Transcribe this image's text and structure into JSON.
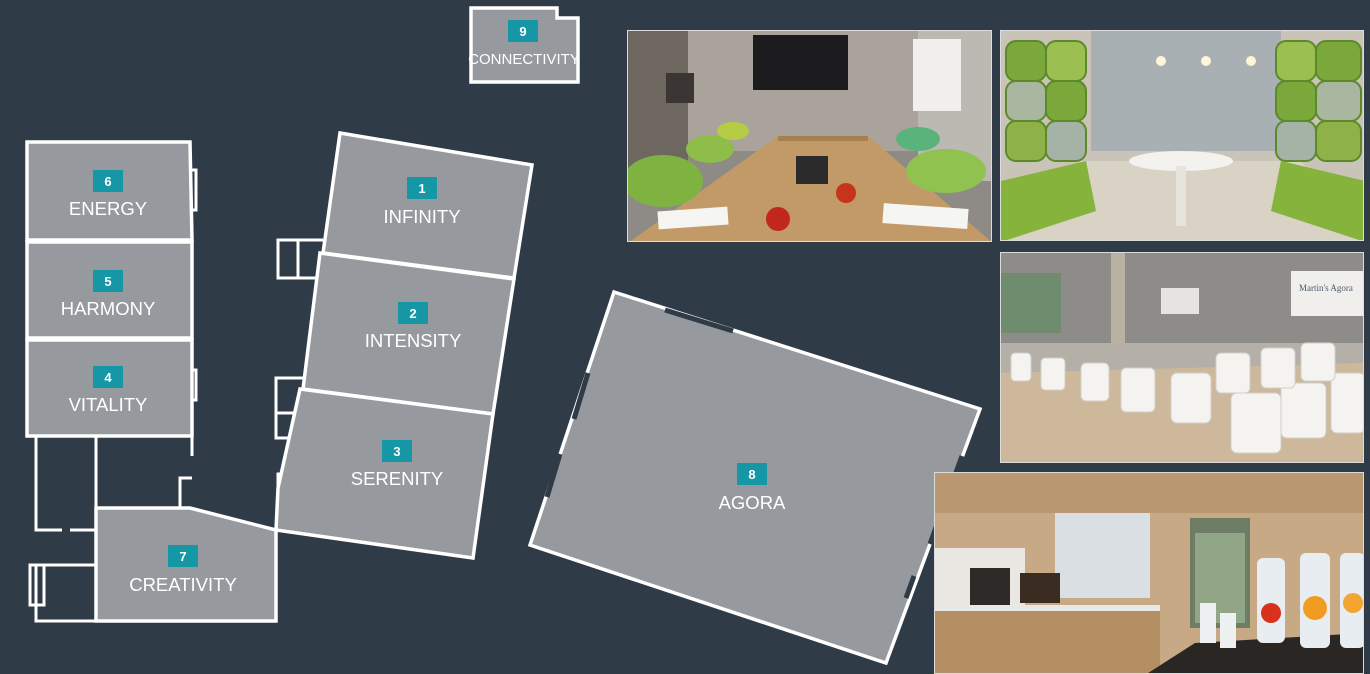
{
  "rooms": [
    {
      "id": "1",
      "name": "INFINITY"
    },
    {
      "id": "2",
      "name": "INTENSITY"
    },
    {
      "id": "3",
      "name": "SERENITY"
    },
    {
      "id": "4",
      "name": "VITALITY"
    },
    {
      "id": "5",
      "name": "HARMONY"
    },
    {
      "id": "6",
      "name": "ENERGY"
    },
    {
      "id": "7",
      "name": "CREATIVITY"
    },
    {
      "id": "8",
      "name": "AGORA"
    },
    {
      "id": "9",
      "name": "CONNECTIVITY"
    }
  ],
  "photos": [
    {
      "name": "boardroom-photo",
      "subject": "boardroom table with green chairs and wall screen"
    },
    {
      "name": "lounge-photo",
      "subject": "lounge with green padded seating pods and round table"
    },
    {
      "name": "theatre-photo",
      "subject": "theatre-style rows of white chairs facing screens",
      "sign_text": "Martin's Agora"
    },
    {
      "name": "coffee-break-photo",
      "subject": "coffee break counter with fruit-infused water carafes"
    }
  ],
  "colors": {
    "background": "#2f3b47",
    "room_fill": "#96999e",
    "room_outline": "#ffffff",
    "number_badge": "#1597a5"
  }
}
